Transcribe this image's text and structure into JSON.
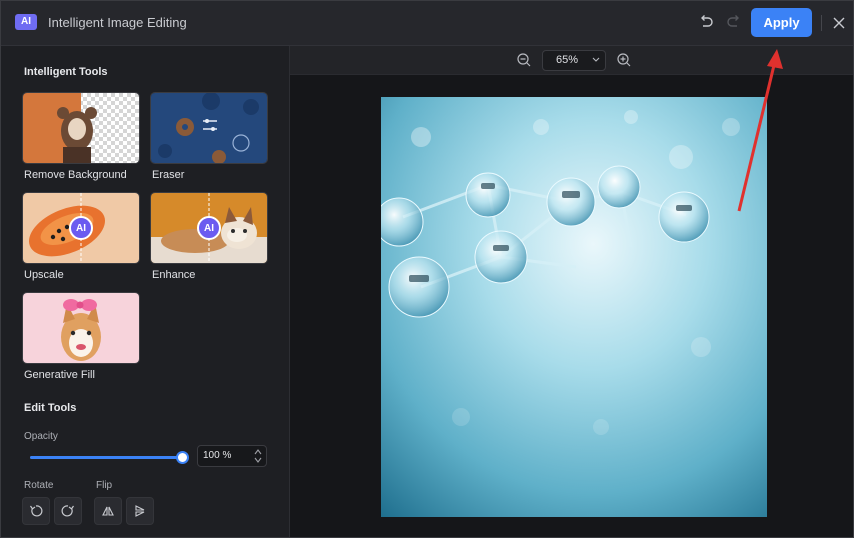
{
  "app": {
    "logo_text": "AI",
    "title": "Intelligent Image Editing",
    "apply_label": "Apply"
  },
  "panel": {
    "intelligent_tools_title": "Intelligent Tools",
    "tools": [
      {
        "label": "Remove Background"
      },
      {
        "label": "Eraser"
      },
      {
        "label": "Upscale",
        "badge": "AI"
      },
      {
        "label": "Enhance",
        "badge": "AI"
      },
      {
        "label": "Generative Fill"
      }
    ],
    "edit_tools_title": "Edit Tools",
    "opacity_label": "Opacity",
    "opacity_value": "100 %",
    "opacity_fraction": 1.0,
    "rotate_label": "Rotate",
    "flip_label": "Flip"
  },
  "canvas": {
    "zoom_value": "65%"
  },
  "colors": {
    "accent": "#3b82f6",
    "ai_badge": "#6b5bf0",
    "annotation_arrow": "#e0312e"
  }
}
